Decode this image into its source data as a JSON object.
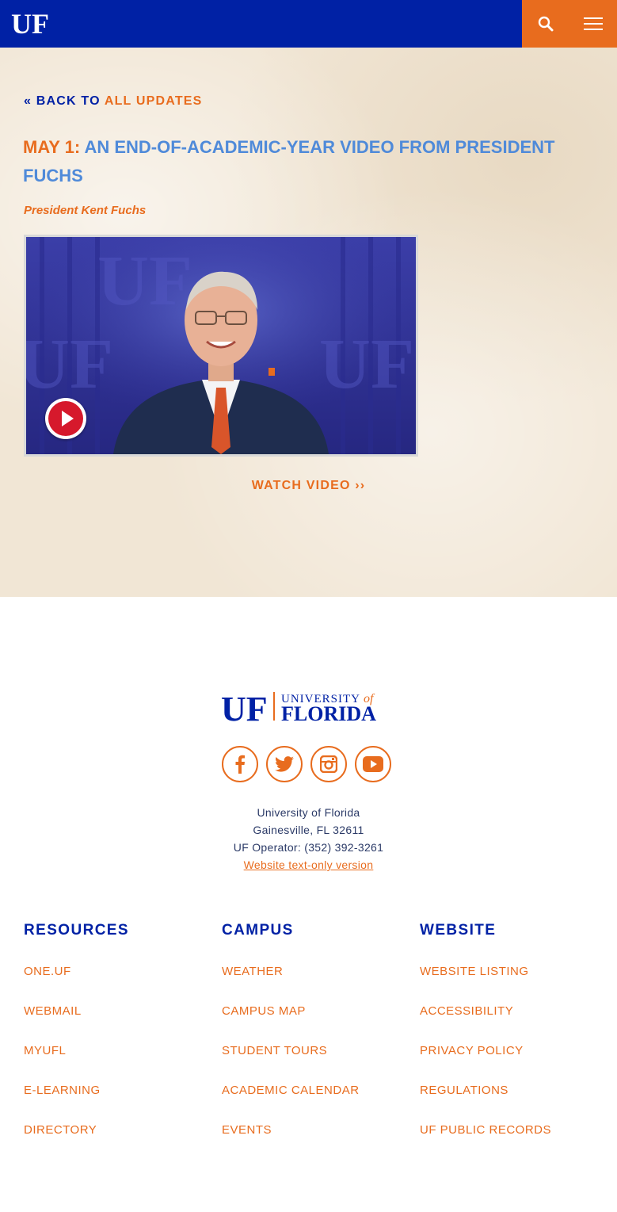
{
  "header": {
    "logo_text": "UF",
    "search_icon": "search-icon",
    "menu_icon": "hamburger-menu-icon",
    "colors": {
      "brand_blue": "#0021a5",
      "brand_orange": "#e86c1e"
    }
  },
  "back": {
    "prefix": "« BACK TO",
    "link": "ALL UPDATES"
  },
  "article": {
    "date": "MAY 1:",
    "title": "AN END-OF-ACADEMIC-YEAR VIDEO FROM PRESIDENT FUCHS",
    "subtitle": "President Kent Fuchs",
    "video_thumbnail_icon": "play-icon",
    "watch_label": "WATCH VIDEO ››"
  },
  "footer": {
    "logo_uf": "UF",
    "logo_university": "UNIVERSITY",
    "logo_of": "of",
    "logo_florida": "FLORIDA",
    "social": [
      "facebook-icon",
      "twitter-icon",
      "instagram-icon",
      "youtube-icon"
    ],
    "address_line1": "University of Florida",
    "address_line2": "Gainesville, FL 32611",
    "operator": "UF Operator: (352) 392-3261",
    "text_only": "Website text-only version",
    "columns": [
      {
        "heading": "RESOURCES",
        "links": [
          "ONE.UF",
          "WEBMAIL",
          "MYUFL",
          "E-LEARNING",
          "DIRECTORY"
        ]
      },
      {
        "heading": "CAMPUS",
        "links": [
          "WEATHER",
          "CAMPUS MAP",
          "STUDENT TOURS",
          "ACADEMIC CALENDAR",
          "EVENTS"
        ]
      },
      {
        "heading": "WEBSITE",
        "links": [
          "WEBSITE LISTING",
          "ACCESSIBILITY",
          "PRIVACY POLICY",
          "REGULATIONS",
          "UF PUBLIC RECORDS"
        ]
      }
    ]
  }
}
